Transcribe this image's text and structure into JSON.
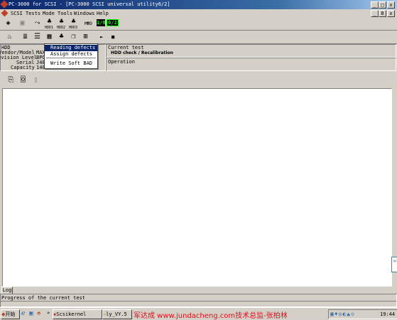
{
  "window": {
    "title": "PC-3000 for SCSI  - [PC-3000 SCSI universal utility6/2]",
    "caption_buttons": [
      "_",
      "□",
      "x"
    ],
    "mdi_buttons": [
      "_",
      "8",
      "x"
    ]
  },
  "menu": [
    "SCSI",
    "Tests",
    "Mode",
    "Tools",
    "Windows",
    "Help"
  ],
  "toolbar1": {
    "lcd_left": "1/0",
    "lcd_right": "6/2",
    "labels": [
      "HDD1",
      "HDD2",
      "HDD3",
      "HDD"
    ]
  },
  "toolbar2": {
    "play": "►",
    "stop": "■"
  },
  "hdd_panel": {
    "heading": "HDD",
    "rows": [
      {
        "label": "Vendor/Model",
        "value": "MAX"
      },
      {
        "label": "Revision Level",
        "value": "BPO"
      },
      {
        "label": "Serial",
        "value": "J48"
      },
      {
        "label": "Capacity",
        "value": "140"
      }
    ]
  },
  "dropdown": {
    "items": [
      "Reading defects",
      "Assign defects",
      "Write Soft BAD"
    ]
  },
  "current_test": {
    "heading": "Current test",
    "value": "HDD check / Recalibration"
  },
  "operation": {
    "heading": "Operation"
  },
  "log": {
    "tab": "Log",
    "progress_label": "Progress of the current test"
  },
  "taskbar": {
    "start": "开始",
    "tasks": [
      "Scsikernel",
      "ly_VY.5"
    ],
    "watermark": "军达成 www.jundacheng.com技术总监-张柏林",
    "clock": "19:44"
  },
  "colors": {
    "title_start": "#0a246a",
    "title_end": "#a6caf0",
    "watermark": "#e0101a",
    "lcd": "#00ff00"
  }
}
